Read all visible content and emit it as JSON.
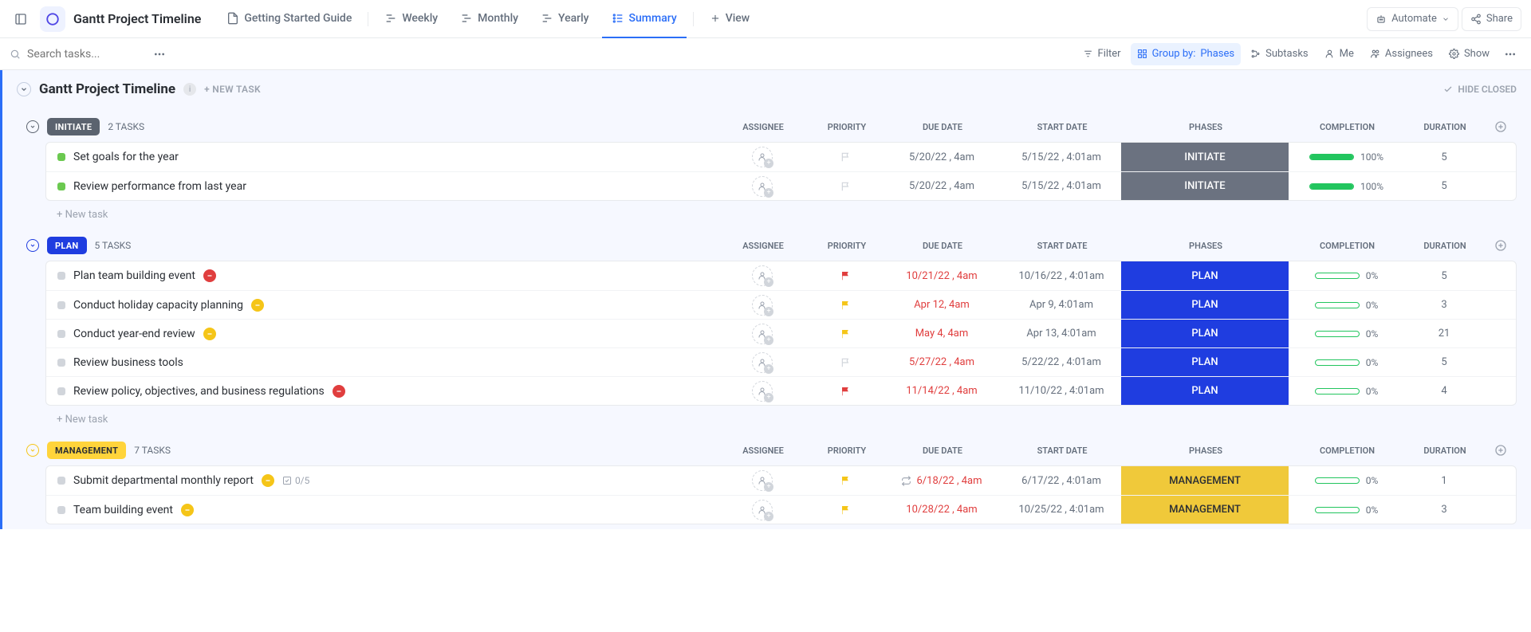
{
  "header": {
    "title": "Gantt Project Timeline",
    "tabs": [
      {
        "label": "Getting Started Guide",
        "icon": "doc"
      },
      {
        "label": "Weekly",
        "icon": "gantt"
      },
      {
        "label": "Monthly",
        "icon": "gantt"
      },
      {
        "label": "Yearly",
        "icon": "gantt"
      },
      {
        "label": "Summary",
        "icon": "list",
        "active": true
      }
    ],
    "addView": "View",
    "automate": "Automate",
    "share": "Share"
  },
  "toolbar": {
    "searchPlaceholder": "Search tasks...",
    "filter": "Filter",
    "groupByLabel": "Group by:",
    "groupByValue": "Phases",
    "subtasks": "Subtasks",
    "me": "Me",
    "assignees": "Assignees",
    "show": "Show"
  },
  "listHeader": {
    "title": "Gantt Project Timeline",
    "newTask": "+ NEW TASK",
    "hideClosed": "HIDE CLOSED"
  },
  "columns": {
    "assignee": "ASSIGNEE",
    "priority": "PRIORITY",
    "dueDate": "DUE DATE",
    "startDate": "START DATE",
    "phases": "PHASES",
    "completion": "COMPLETION",
    "duration": "DURATION"
  },
  "newTaskRow": "+ New task",
  "groups": [
    {
      "id": "initiate",
      "badge": "INITIATE",
      "badgeBg": "#5b636f",
      "badgeFg": "#ffffff",
      "collapseColor": "#5b636f",
      "count": "2 TASKS",
      "phaseBg": "#6b7280",
      "phaseFg": "#ffffff",
      "statusColor": "#6bc950",
      "tasks": [
        {
          "name": "Set goals for the year",
          "dueDate": "5/20/22 , 4am",
          "overdue": false,
          "startDate": "5/15/22 , 4:01am",
          "phase": "INITIATE",
          "completion": 100,
          "duration": "5",
          "priority": "none"
        },
        {
          "name": "Review performance from last year",
          "dueDate": "5/20/22 , 4am",
          "overdue": false,
          "startDate": "5/15/22 , 4:01am",
          "phase": "INITIATE",
          "completion": 100,
          "duration": "5",
          "priority": "none"
        }
      ]
    },
    {
      "id": "plan",
      "badge": "PLAN",
      "badgeBg": "#1f3de0",
      "badgeFg": "#ffffff",
      "collapseColor": "#1f3de0",
      "count": "5 TASKS",
      "phaseBg": "#1f3de0",
      "phaseFg": "#ffffff",
      "statusColor": "#d1d5db",
      "tasks": [
        {
          "name": "Plan team building event",
          "dueDate": "10/21/22 , 4am",
          "overdue": true,
          "startDate": "10/16/22 , 4:01am",
          "phase": "PLAN",
          "completion": 0,
          "duration": "5",
          "priority": "urgent",
          "nameBadge": "urgent"
        },
        {
          "name": "Conduct holiday capacity planning",
          "dueDate": "Apr 12, 4am",
          "overdue": true,
          "startDate": "Apr 9, 4:01am",
          "phase": "PLAN",
          "completion": 0,
          "duration": "3",
          "priority": "normal",
          "nameBadge": "normal"
        },
        {
          "name": "Conduct year-end review",
          "dueDate": "May 4, 4am",
          "overdue": true,
          "startDate": "Apr 13, 4:01am",
          "phase": "PLAN",
          "completion": 0,
          "duration": "21",
          "priority": "normal",
          "nameBadge": "normal"
        },
        {
          "name": "Review business tools",
          "dueDate": "5/27/22 , 4am",
          "overdue": true,
          "startDate": "5/22/22 , 4:01am",
          "phase": "PLAN",
          "completion": 0,
          "duration": "5",
          "priority": "none"
        },
        {
          "name": "Review policy, objectives, and business regulations",
          "dueDate": "11/14/22 , 4am",
          "overdue": true,
          "startDate": "11/10/22 , 4:01am",
          "phase": "PLAN",
          "completion": 0,
          "duration": "4",
          "priority": "urgent",
          "nameBadge": "urgent"
        }
      ]
    },
    {
      "id": "management",
      "badge": "MANAGEMENT",
      "badgeBg": "#ffd43b",
      "badgeFg": "#2a2e34",
      "collapseColor": "#f5c518",
      "count": "7 TASKS",
      "phaseBg": "#f0c93a",
      "phaseFg": "#2a2e34",
      "statusColor": "#d1d5db",
      "tasks": [
        {
          "name": "Submit departmental monthly report",
          "dueDate": "6/18/22 , 4am",
          "overdue": true,
          "startDate": "6/17/22 , 4:01am",
          "phase": "MANAGEMENT",
          "completion": 0,
          "duration": "1",
          "priority": "normal",
          "nameBadge": "normal",
          "subtask": "0/5",
          "recurring": true
        },
        {
          "name": "Team building event",
          "dueDate": "10/28/22 , 4am",
          "overdue": true,
          "startDate": "10/25/22 , 4:01am",
          "phase": "MANAGEMENT",
          "completion": 0,
          "duration": "3",
          "priority": "normal",
          "nameBadge": "normal"
        }
      ]
    }
  ]
}
